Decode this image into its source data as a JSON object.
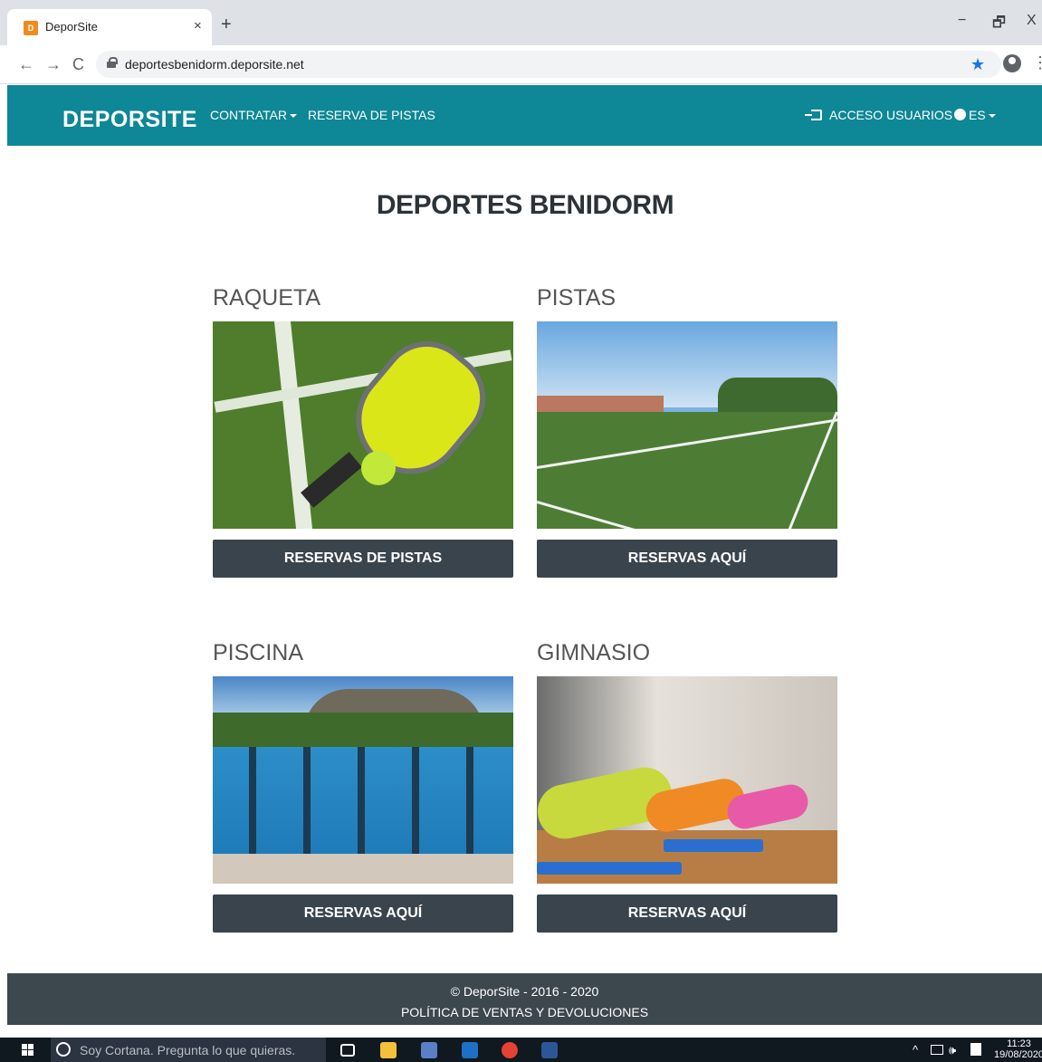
{
  "browser": {
    "tab_title": "DeporSite",
    "favicon_text": "D",
    "tab_close": "×",
    "new_tab": "+",
    "back": "←",
    "forward": "→",
    "reload": "C",
    "url": "deportesbenidorm.deporsite.net",
    "bookmark_star": "★",
    "menu": "⋮",
    "minimize": "−",
    "maximize": "🗗",
    "close": "X"
  },
  "navbar": {
    "brand": "DEPORSITE",
    "contratar": "CONTRATAR",
    "reserva_pistas": "RESERVA DE PISTAS",
    "acceso_usuarios": "ACCESO USUARIOS",
    "language": "ES",
    "color": "#0e8796"
  },
  "main": {
    "title": "DEPORTES BENIDORM",
    "cards": [
      {
        "title": "RAQUETA",
        "button": "RESERVAS DE PISTAS"
      },
      {
        "title": "PISTAS",
        "button": "RESERVAS AQUÍ"
      },
      {
        "title": "PISCINA",
        "button": "RESERVAS AQUÍ"
      },
      {
        "title": "GIMNASIO",
        "button": "RESERVAS AQUÍ"
      }
    ],
    "button_color": "#3a444c"
  },
  "footer": {
    "copyright": "© DeporSite - 2016 - 2020",
    "policy_link": "POLÍTICA DE VENTAS Y DEVOLUCIONES",
    "color": "#3d474e"
  },
  "taskbar": {
    "search_placeholder": "Soy Cortana. Pregunta lo que quieras.",
    "time": "11:23",
    "date": "19/08/2020",
    "tray_chevron": "^",
    "tray_volume": "🕪"
  }
}
